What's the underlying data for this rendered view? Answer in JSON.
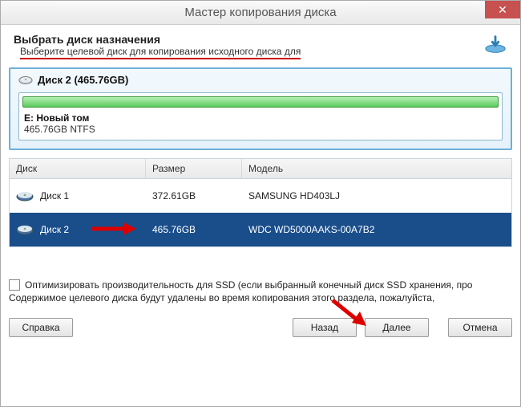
{
  "window": {
    "title": "Мастер копирования диска"
  },
  "header": {
    "title": "Выбрать диск назначения",
    "subtitle": "Выберите целевой диск для копирования исходного диска для"
  },
  "target_disk": {
    "title": "Диск 2 (465.76GB)",
    "volume_name": "E: Новый том",
    "volume_details": "465.76GB NTFS"
  },
  "table": {
    "columns": {
      "disk": "Диск",
      "size": "Размер",
      "model": "Модель"
    },
    "rows": [
      {
        "disk": "Диск 1",
        "size": "372.61GB",
        "model": "SAMSUNG HD403LJ",
        "selected": false
      },
      {
        "disk": "Диск 2",
        "size": "465.76GB",
        "model": "WDC WD5000AAKS-00A7B2",
        "selected": true
      }
    ]
  },
  "ssd": {
    "label": "Оптимизировать производительность для SSD (если выбранный конечный диск SSD хранения, про",
    "note": "Содержимое целевого диска будут удалены во время копирования этого раздела, пожалуйста,"
  },
  "buttons": {
    "help": "Справка",
    "back": "Назад",
    "next": "Далее",
    "cancel": "Отмена"
  }
}
